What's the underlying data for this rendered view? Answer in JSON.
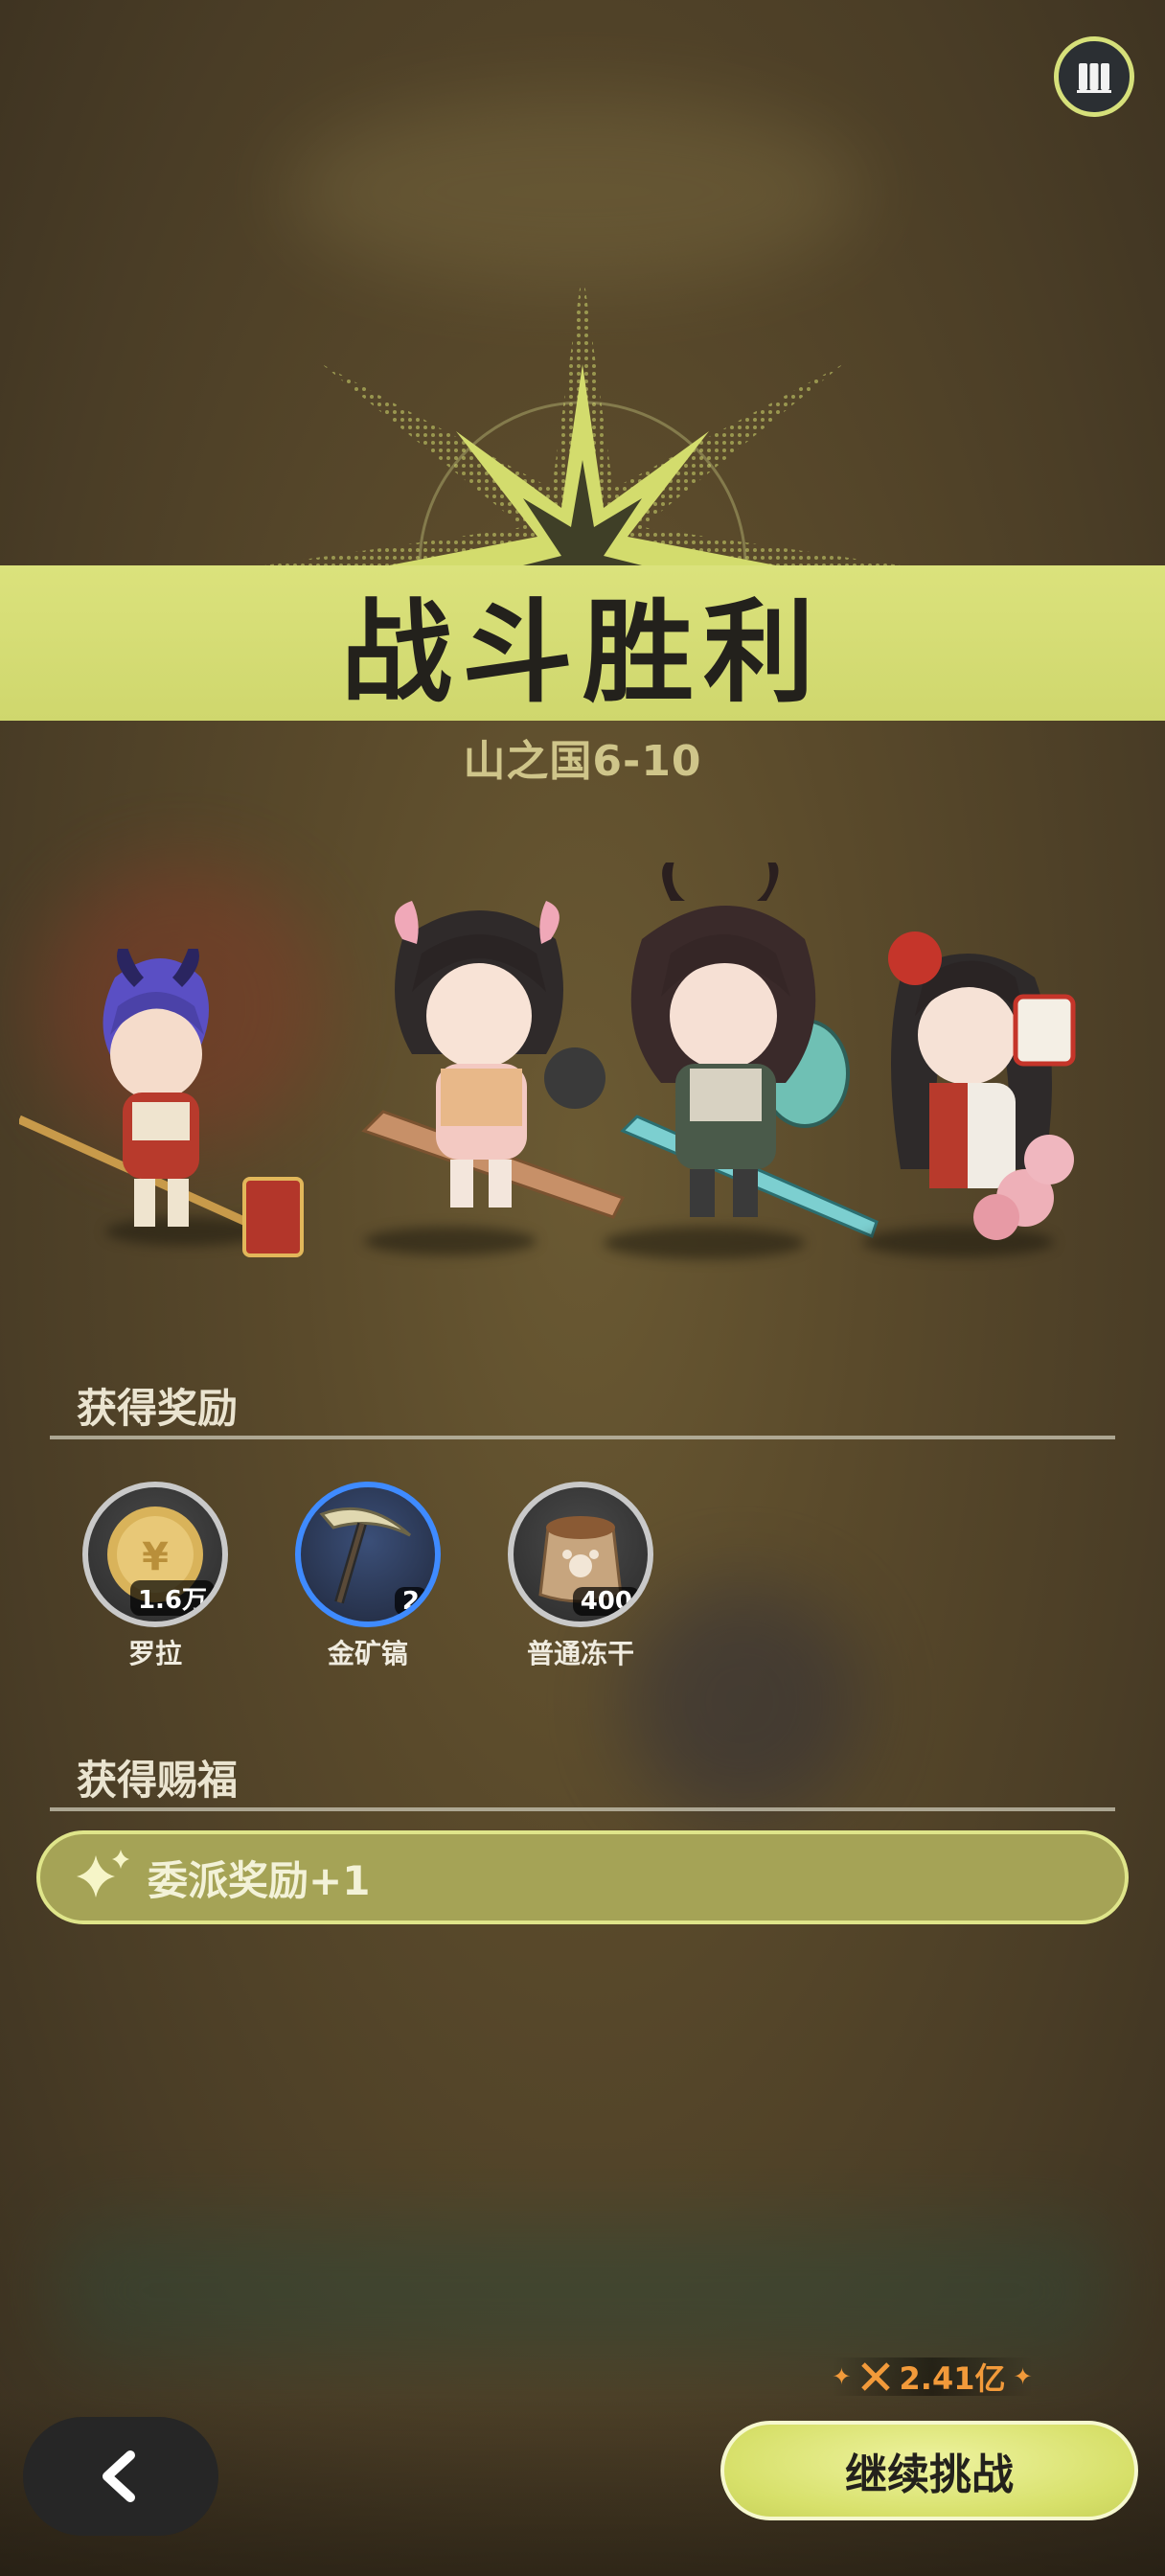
{
  "title": "战斗胜利",
  "stage": "山之国6-10",
  "sections": {
    "rewards_title": "获得奖励",
    "blessings_title": "获得赐福"
  },
  "rewards": [
    {
      "name": "罗拉",
      "count": "1.6万",
      "icon": "gold-coin-icon"
    },
    {
      "name": "金矿镐",
      "count": "2",
      "icon": "pickaxe-icon"
    },
    {
      "name": "普通冻干",
      "count": "400",
      "icon": "food-bag-icon"
    }
  ],
  "blessing": {
    "label": "委派奖励+1",
    "icon": "sparkle-icon"
  },
  "power": {
    "value": "2.41亿",
    "icon": "crossed-swords-icon"
  },
  "buttons": {
    "continue": "继续挑战",
    "back_icon": "back-arrow-icon",
    "book_icon": "book-icon"
  },
  "colors": {
    "banner": "#d6de74",
    "accent_orange": "#f29a3a",
    "reward_blue_border": "#3f8bff"
  }
}
